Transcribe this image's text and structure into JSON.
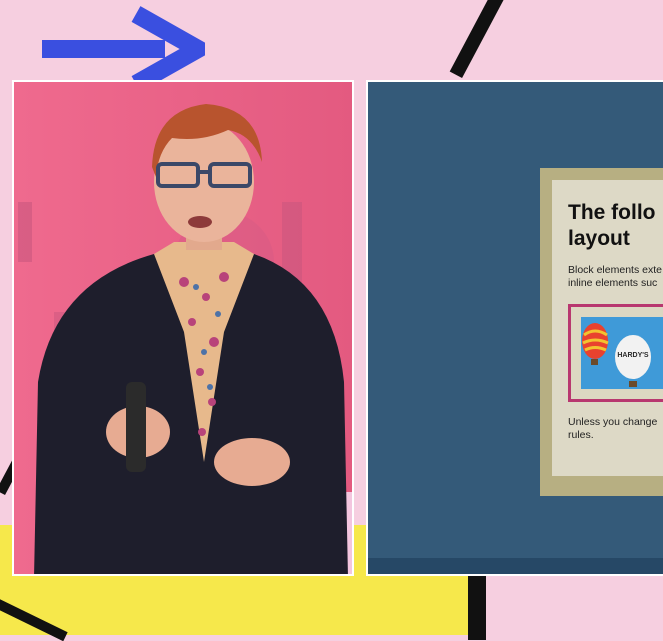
{
  "colors": {
    "background": "#f6cfe0",
    "accent_yellow": "#f6e84b",
    "arrow_blue": "#3a4fe0",
    "speaker_backdrop": "#ea5f86",
    "slide_background": "#345a79",
    "slide_card": "#ddd9c6",
    "slide_card_border": "#b7af82",
    "example_border": "#b8376f"
  },
  "icons": {
    "arrow": "arrow-right-icon"
  },
  "slide": {
    "title": "The follo\nlayout",
    "body": "Block elements exte\ninline elements suc",
    "example_image_text": "HARDY'S",
    "footer": "Unless you change\nrules."
  }
}
